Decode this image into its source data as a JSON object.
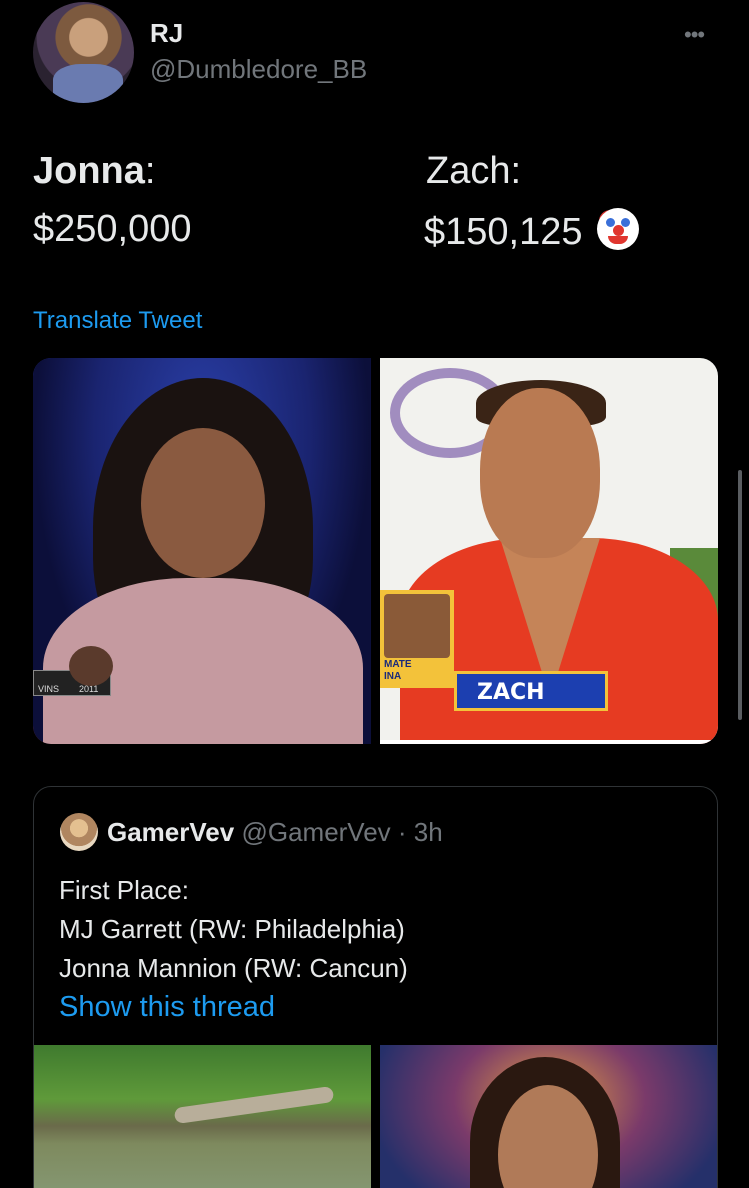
{
  "tweet": {
    "author_name": "RJ",
    "author_handle": "@Dumbledore_BB",
    "more_label": "•••",
    "lines": {
      "left_name": "Jonna",
      "left_colon": ":",
      "left_amount": "$250,000",
      "right_label": "Zach:",
      "right_amount": "$150,125"
    },
    "translate_label": "Translate Tweet",
    "media": {
      "left_tag_text": "VINS",
      "left_tag_year": "2011",
      "right_card_label_1": "MATE",
      "right_card_label_2": "INA",
      "right_banner_text": "ZACH"
    }
  },
  "quoted_tweet": {
    "author_name": "GamerVev",
    "author_handle": "@GamerVev",
    "separator": " · ",
    "time": "3h",
    "body_lines": [
      "First Place:",
      "MJ Garrett (RW: Philadelphia)",
      "Jonna Mannion (RW: Cancun)"
    ],
    "show_thread_label": "Show this thread"
  },
  "colors": {
    "background": "#000000",
    "primary_text": "#e7e9ea",
    "secondary_text": "#71767b",
    "accent": "#1d9bf0",
    "border": "#2f3336"
  }
}
